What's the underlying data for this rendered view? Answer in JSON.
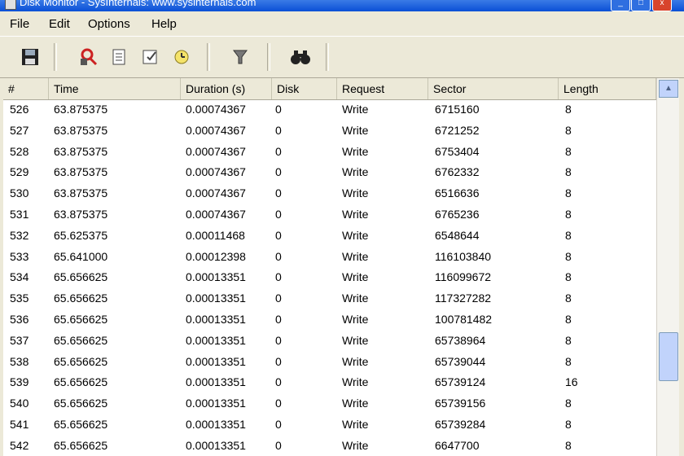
{
  "window": {
    "title": "Disk Monitor - SysInternals: www.sysinternals.com",
    "buttons": {
      "minimize": "_",
      "maximize": "□",
      "close": "x"
    }
  },
  "menu": {
    "file": "File",
    "edit": "Edit",
    "options": "Options",
    "help": "Help"
  },
  "toolbar": {
    "save_icon": "floppy-disk-icon",
    "capture_icon": "magnifier-capture-icon",
    "clear_icon": "clear-display-icon",
    "timestamp_icon": "timestamp-icon",
    "autoscroll_icon": "autoscroll-icon",
    "filter_icon": "filter-icon",
    "find_icon": "binoculars-icon"
  },
  "table": {
    "columns": [
      "#",
      "Time",
      "Duration (s)",
      "Disk",
      "Request",
      "Sector",
      "Length"
    ],
    "rows": [
      [
        "526",
        "63.875375",
        "0.00074367",
        "0",
        "Write",
        "6715160",
        "8"
      ],
      [
        "527",
        "63.875375",
        "0.00074367",
        "0",
        "Write",
        "6721252",
        "8"
      ],
      [
        "528",
        "63.875375",
        "0.00074367",
        "0",
        "Write",
        "6753404",
        "8"
      ],
      [
        "529",
        "63.875375",
        "0.00074367",
        "0",
        "Write",
        "6762332",
        "8"
      ],
      [
        "530",
        "63.875375",
        "0.00074367",
        "0",
        "Write",
        "6516636",
        "8"
      ],
      [
        "531",
        "63.875375",
        "0.00074367",
        "0",
        "Write",
        "6765236",
        "8"
      ],
      [
        "532",
        "65.625375",
        "0.00011468",
        "0",
        "Write",
        "6548644",
        "8"
      ],
      [
        "533",
        "65.641000",
        "0.00012398",
        "0",
        "Write",
        "116103840",
        "8"
      ],
      [
        "534",
        "65.656625",
        "0.00013351",
        "0",
        "Write",
        "116099672",
        "8"
      ],
      [
        "535",
        "65.656625",
        "0.00013351",
        "0",
        "Write",
        "117327282",
        "8"
      ],
      [
        "536",
        "65.656625",
        "0.00013351",
        "0",
        "Write",
        "100781482",
        "8"
      ],
      [
        "537",
        "65.656625",
        "0.00013351",
        "0",
        "Write",
        "65738964",
        "8"
      ],
      [
        "538",
        "65.656625",
        "0.00013351",
        "0",
        "Write",
        "65739044",
        "8"
      ],
      [
        "539",
        "65.656625",
        "0.00013351",
        "0",
        "Write",
        "65739124",
        "16"
      ],
      [
        "540",
        "65.656625",
        "0.00013351",
        "0",
        "Write",
        "65739156",
        "8"
      ],
      [
        "541",
        "65.656625",
        "0.00013351",
        "0",
        "Write",
        "65739284",
        "8"
      ],
      [
        "542",
        "65.656625",
        "0.00013351",
        "0",
        "Write",
        "6647700",
        "8"
      ]
    ]
  },
  "colors": {
    "titlebar": "#0a4fd6",
    "chrome": "#ece9d8",
    "list_bg": "#ffffff",
    "scroll": "#c1d3fb"
  }
}
